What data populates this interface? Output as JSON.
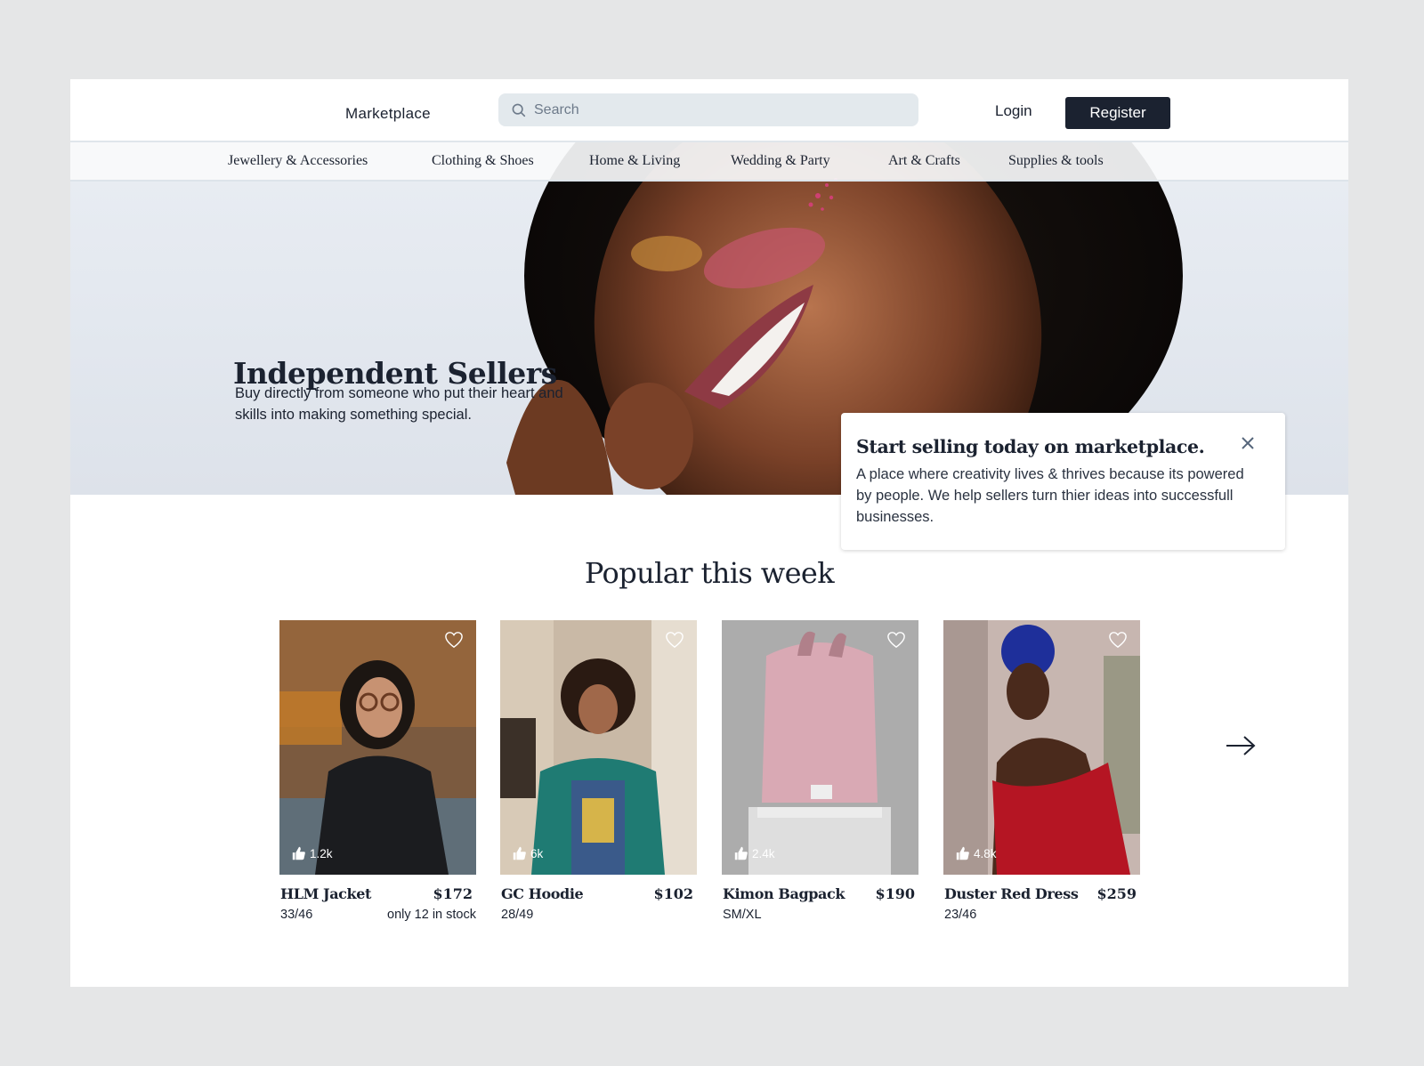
{
  "header": {
    "brand": "Marketplace",
    "search_placeholder": "Search",
    "login_label": "Login",
    "register_label": "Register"
  },
  "categories": [
    {
      "label": "Jewellery & Accessories"
    },
    {
      "label": "Clothing & Shoes"
    },
    {
      "label": "Home & Living"
    },
    {
      "label": "Wedding & Party"
    },
    {
      "label": "Art & Crafts"
    },
    {
      "label": "Supplies & tools"
    }
  ],
  "hero": {
    "title": "Independent Sellers",
    "subtitle": "Buy directly from someone who put their heart and skills into making something special."
  },
  "popup": {
    "title": "Start selling today on marketplace.",
    "body": "A place where creativity lives & thrives because its powered by people. We help sellers turn thier ideas into successfull businesses."
  },
  "popular": {
    "title": "Popular this week",
    "products": [
      {
        "name": "HLM Jacket",
        "price": "$172",
        "meta": "33/46",
        "stock": "only 12 in stock",
        "likes": "1.2k"
      },
      {
        "name": "GC Hoodie",
        "price": "$102",
        "meta": "28/49",
        "stock": "",
        "likes": "6k"
      },
      {
        "name": "Kimon Bagpack",
        "price": "$190",
        "meta": "SM/XL",
        "stock": "",
        "likes": "2.4k"
      },
      {
        "name": "Duster Red Dress",
        "price": "$259",
        "meta": "23/46",
        "stock": "",
        "likes": "4.8k"
      }
    ]
  },
  "colors": {
    "primary": "#1b2230",
    "search_bg": "#e3e9ed",
    "page_bg": "#e5e6e7"
  }
}
